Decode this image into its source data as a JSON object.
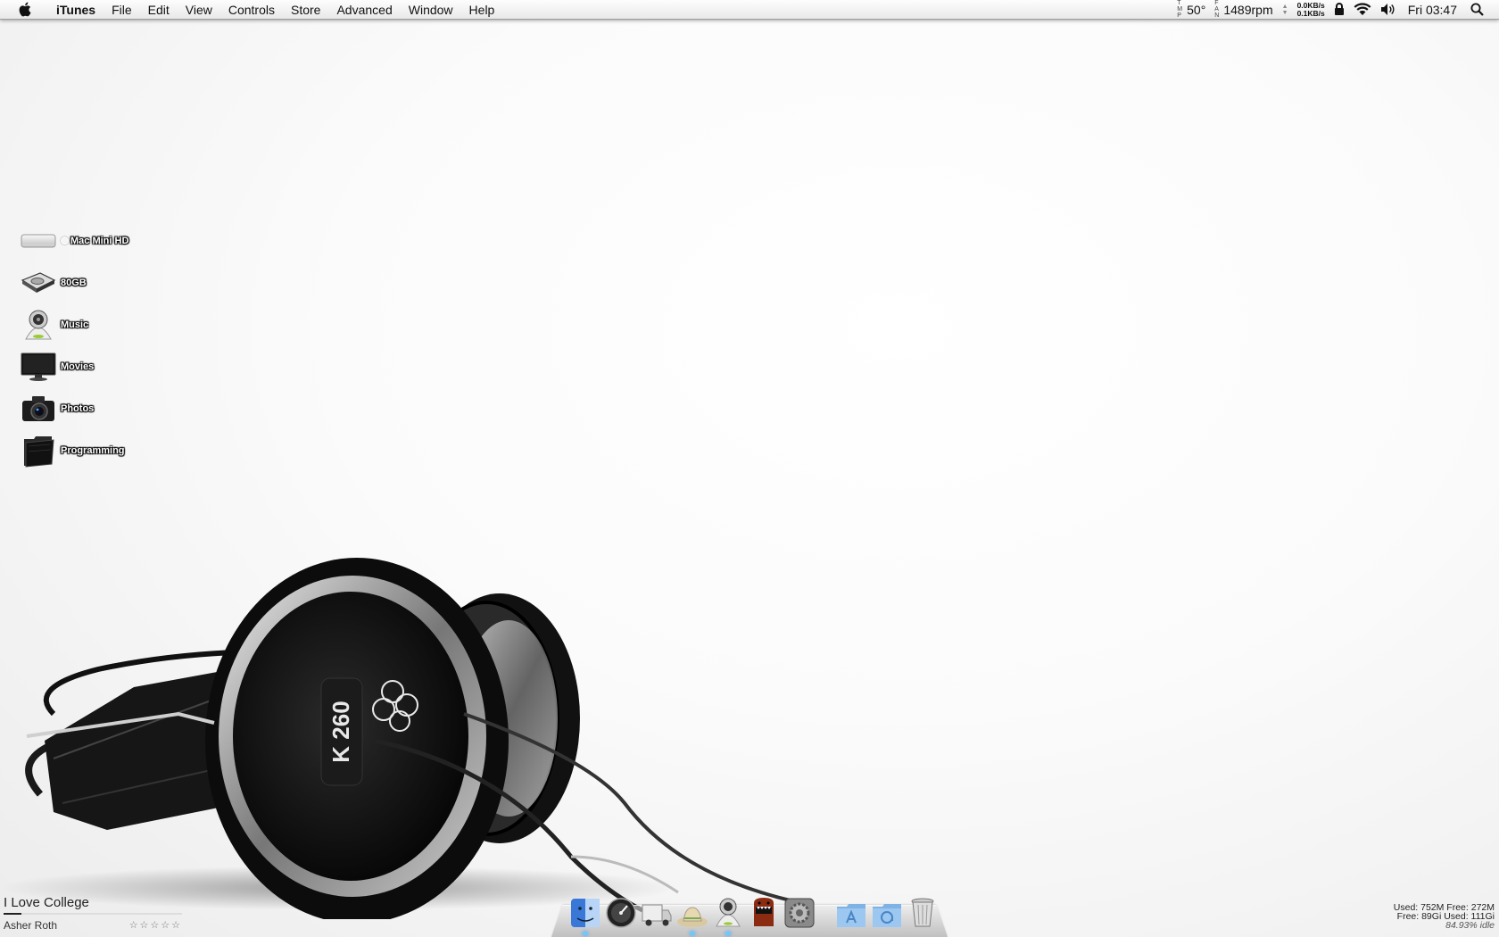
{
  "menubar": {
    "app_name": "iTunes",
    "items": [
      "File",
      "Edit",
      "View",
      "Controls",
      "Store",
      "Advanced",
      "Window",
      "Help"
    ],
    "status": {
      "temp_label": [
        "T",
        "M",
        "P"
      ],
      "temp": "50°",
      "fan_label": [
        "F",
        "A",
        "N"
      ],
      "fan": "1489rpm",
      "net_down": "0.0KB/s",
      "net_up": "0.1KB/s",
      "clock": "Fri 03:47",
      "icons": [
        "lock-icon",
        "wifi-icon",
        "volume-icon",
        "spotlight-icon"
      ]
    }
  },
  "desktop": {
    "items": [
      {
        "label": "Mac Mini HD",
        "icon": "mac-mini-drive-icon"
      },
      {
        "label": "80GB",
        "icon": "hard-drive-icon"
      },
      {
        "label": "Music",
        "icon": "music-speaker-icon"
      },
      {
        "label": "Movies",
        "icon": "monitor-icon"
      },
      {
        "label": "Photos",
        "icon": "camera-icon"
      },
      {
        "label": "Programming",
        "icon": "folder-icon"
      }
    ]
  },
  "now_playing": {
    "title": "I Love College",
    "artist": "Asher Roth",
    "rating": "☆☆☆☆☆",
    "progress": 0.1
  },
  "dock": {
    "items": [
      "finder-icon",
      "dashboard-icon",
      "transmit-truck-icon",
      "safari-hat-icon",
      "itunes-speaker-icon",
      "domo-icon",
      "system-preferences-icon",
      "applications-folder-icon",
      "documents-folder-icon",
      "trash-icon"
    ]
  },
  "stats": {
    "mem": "Used: 752M Free: 272M",
    "disk": "Free: 89Gi  Used: 111Gi",
    "cpu": "84.93% idle"
  }
}
